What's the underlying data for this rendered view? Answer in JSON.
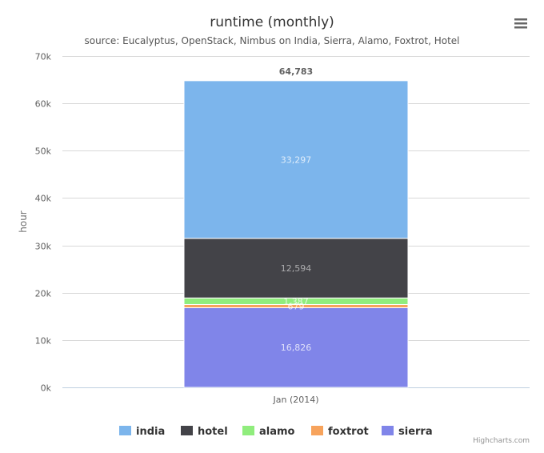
{
  "menu": {
    "icon": "hamburger-menu-icon"
  },
  "credits": "Highcharts.com",
  "chart_data": {
    "type": "bar",
    "stacked": true,
    "orientation": "vertical",
    "title": "runtime (monthly)",
    "subtitle": "source: Eucalyptus, OpenStack, Nimbus on India, Sierra, Alamo, Foxtrot, Hotel",
    "xlabel": "",
    "ylabel": "hour",
    "categories": [
      "Jan (2014)"
    ],
    "ylim": [
      0,
      70000
    ],
    "yticks": [
      0,
      10000,
      20000,
      30000,
      40000,
      50000,
      60000,
      70000
    ],
    "ytick_labels": [
      "0k",
      "10k",
      "20k",
      "30k",
      "40k",
      "50k",
      "60k",
      "70k"
    ],
    "grid": true,
    "legend_position": "bottom-center",
    "stack_totals": [
      "64,783"
    ],
    "series": [
      {
        "name": "sierra",
        "values": [
          16826
        ],
        "label": "16,826",
        "color": "#8085e9"
      },
      {
        "name": "foxtrot",
        "values": [
          679
        ],
        "label": "679",
        "color": "#f7a35c"
      },
      {
        "name": "alamo",
        "values": [
          1387
        ],
        "label": "1,387",
        "color": "#90ed7d"
      },
      {
        "name": "hotel",
        "values": [
          12594
        ],
        "label": "12,594",
        "color": "#434348"
      },
      {
        "name": "india",
        "values": [
          33297
        ],
        "label": "33,297",
        "color": "#7cb5ec"
      }
    ],
    "legend_order": [
      "india",
      "hotel",
      "alamo",
      "foxtrot",
      "sierra"
    ]
  }
}
